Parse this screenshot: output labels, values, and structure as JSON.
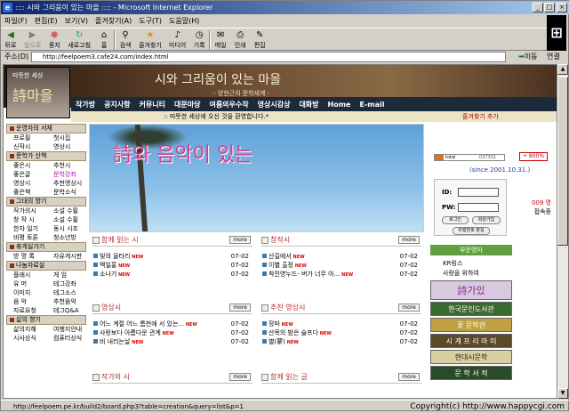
{
  "window": {
    "title": ":::: 시와 그리움이 있는 마을 :::: - Microsoft Internet Explorer"
  },
  "menu": [
    "파일(F)",
    "편집(E)",
    "보기(V)",
    "즐겨찾기(A)",
    "도구(T)",
    "도움말(H)"
  ],
  "toolbar": [
    {
      "icon": "back-icon",
      "label": "뒤로",
      "enabled": true
    },
    {
      "icon": "forward-icon",
      "label": "앞으로",
      "enabled": false
    },
    {
      "icon": "stop-icon",
      "label": "중지",
      "enabled": true
    },
    {
      "icon": "refresh-icon",
      "label": "새로고침",
      "enabled": true
    },
    {
      "icon": "home-icon",
      "label": "홈",
      "enabled": true
    },
    {
      "icon": "search-icon",
      "label": "검색",
      "enabled": true
    },
    {
      "icon": "favorites-icon",
      "label": "즐겨찾기",
      "enabled": true
    },
    {
      "icon": "media-icon",
      "label": "미디어",
      "enabled": true
    },
    {
      "icon": "history-icon",
      "label": "기록",
      "enabled": true
    },
    {
      "icon": "mail-icon",
      "label": "메일",
      "enabled": true
    },
    {
      "icon": "print-icon",
      "label": "인쇄",
      "enabled": true
    },
    {
      "icon": "edit-icon",
      "label": "편집",
      "enabled": true
    }
  ],
  "address": {
    "label": "주소(D)",
    "url": "http://feelpoem3.cafe24.com/index.html",
    "go": "이동",
    "links": "연결"
  },
  "status": {
    "text": "http://feelpoem.pe.kr/build2/board.php3?table=creation&query=list&p=1",
    "copyright": "Copyright(c) http://www.happycgi.com"
  },
  "page": {
    "logo_small": "따뜻한 세상",
    "logo_big": "詩마을",
    "site_title": "시와 그리움이 있는 마을",
    "site_subtitle": "- 양현근의 문학세계 -",
    "nav": [
      "작가방",
      "공지사항",
      "커뮤니티",
      "대문마당",
      "여름의우수작",
      "영상시감상",
      "대화방",
      "Home",
      "E-mail"
    ],
    "welcome": ":: 따뜻한 세상에 오신 것을 환영합니다.*",
    "favorite": "즐겨찾기 추가",
    "banner_text": "詩와 음악이 있는",
    "sidebar": [
      {
        "title": "운영자의 서재",
        "rows": [
          [
            "프로필",
            "첫시집"
          ],
          [
            "신작시",
            "영상시"
          ]
        ]
      },
      {
        "title": "문학가 산책",
        "rows": [
          [
            "좋은시",
            "추천시"
          ],
          [
            "좋은글",
            "문학강좌"
          ],
          [
            "영상시",
            "추천영상시"
          ],
          [
            "좋은책",
            "문학소식"
          ]
        ]
      },
      {
        "title": "그대의 향기",
        "rows": [
          [
            "작가의시",
            "소설 수필"
          ],
          [
            "창 작 시",
            "소설 수필"
          ],
          [
            "한자 일기",
            "동시 시조"
          ],
          [
            "비평 토론",
            "청소년방"
          ]
        ]
      },
      {
        "title": "휴게실가기",
        "rows": [
          [
            "방 명 록",
            "자유게시판"
          ]
        ]
      },
      {
        "title": "나눔자료실",
        "rows": [
          [
            "플래시",
            "게 임"
          ],
          [
            "유 머",
            "테그강좌"
          ],
          [
            "이미지",
            "테그소스"
          ],
          [
            "음 악",
            "추천음악"
          ],
          [
            "자료요청",
            "테그Q&A"
          ]
        ]
      },
      {
        "title": "삶의 향기",
        "rows": [
          [
            "삶의지혜",
            "여행지안내"
          ],
          [
            "시사상식",
            "컴퓨터상식"
          ]
        ]
      }
    ],
    "panels": [
      {
        "title": "함께 읽는 시",
        "more": "more",
        "items": [
          {
            "t": "빛의 울타리",
            "d": "07-02",
            "new": true
          },
          {
            "t": "백일홍",
            "d": "07-02",
            "new": true
          },
          {
            "t": "소나기",
            "d": "07-02",
            "new": true
          }
        ]
      },
      {
        "title": "창작시",
        "more": "more",
        "items": [
          {
            "t": "산길에서",
            "d": "07-02",
            "new": true
          },
          {
            "t": "이별 출정",
            "d": "07-02",
            "new": true
          },
          {
            "t": "착진영누드- 버가 너무 아...",
            "d": "07-02",
            "new": true
          }
        ]
      },
      {
        "title": "영상시",
        "more": "more",
        "items": [
          {
            "t": "어느 계절 어느 틈천에 서 있는...",
            "d": "07-02",
            "new": true
          },
          {
            "t": "사랑보다 아름다운 관계",
            "d": "07-02",
            "new": true
          },
          {
            "t": "비 내리는날",
            "d": "07-02",
            "new": true
          }
        ]
      },
      {
        "title": "추천 영상시",
        "more": "more",
        "items": [
          {
            "t": "장마",
            "d": "07-02",
            "new": true
          },
          {
            "t": "산목의 밤은 슬프다",
            "d": "07-02",
            "new": true
          },
          {
            "t": "별(蓼)",
            "d": "07-02",
            "new": true
          }
        ]
      },
      {
        "title": "작가의 시",
        "more": "more",
        "items": []
      },
      {
        "title": "함께 읽는 글",
        "more": "more",
        "items": []
      }
    ],
    "counter": {
      "label": "total",
      "value": "037301",
      "plus": "+ 800%",
      "since": "(since 2001.10.31.)"
    },
    "login": {
      "id": "ID:",
      "pw": "PW:",
      "login": "로그인",
      "join": "회원가입",
      "lost": "비밀번호 분실",
      "online_count": "009 명",
      "online_label": "접속중"
    },
    "partner": {
      "title": "부운영자",
      "links": [
        "KR링스",
        "사랑을 위하여"
      ],
      "banners": [
        "詩가있",
        "한국문인도서관",
        "꽃 문학관",
        "시 계 프 리 마 미",
        "현대시문학",
        "문 학 서 적"
      ]
    }
  }
}
